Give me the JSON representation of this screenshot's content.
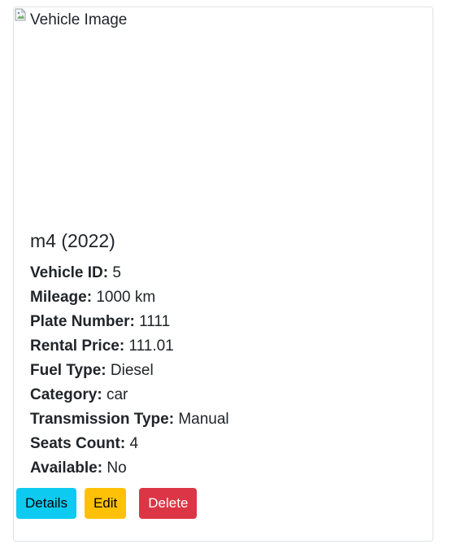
{
  "vehicle": {
    "image_alt": "Vehicle Image",
    "title": "m4 (2022)",
    "fields": [
      {
        "label": "Vehicle ID:",
        "value": "5"
      },
      {
        "label": "Mileage:",
        "value": "1000 km"
      },
      {
        "label": "Plate Number:",
        "value": "1111"
      },
      {
        "label": "Rental Price:",
        "value": "111.01"
      },
      {
        "label": "Fuel Type:",
        "value": "Diesel"
      },
      {
        "label": "Category:",
        "value": "car"
      },
      {
        "label": "Transmission Type:",
        "value": "Manual"
      },
      {
        "label": "Seats Count:",
        "value": "4"
      },
      {
        "label": "Available:",
        "value": "No"
      }
    ]
  },
  "actions": {
    "details_label": "Details",
    "edit_label": "Edit",
    "delete_label": "Delete"
  },
  "colors": {
    "details": "#0dcaf0",
    "edit": "#ffc107",
    "delete": "#dc3545",
    "border": "#dee2e6"
  },
  "icons": {
    "image_placeholder": "broken-image-icon"
  }
}
